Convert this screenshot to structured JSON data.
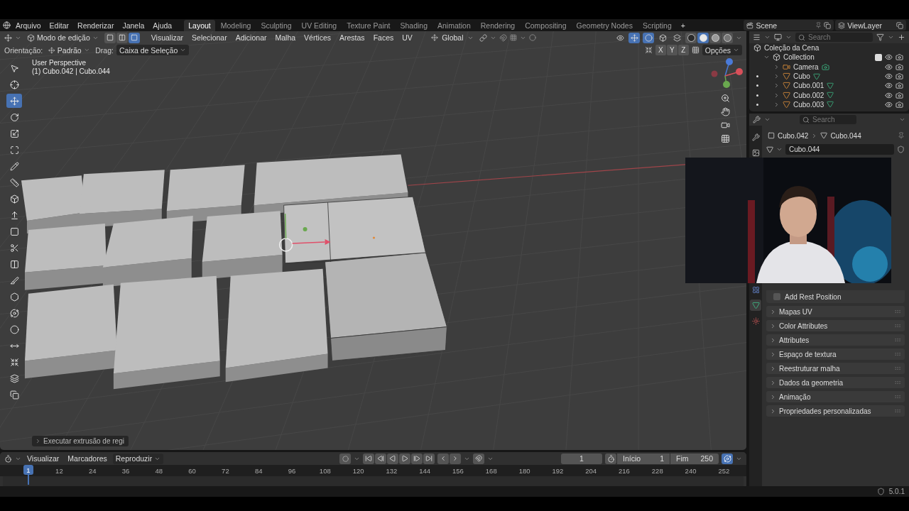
{
  "menu": [
    "Arquivo",
    "Editar",
    "Renderizar",
    "Janela",
    "Ajuda"
  ],
  "workspaces": [
    {
      "label": "Layout",
      "selected": true
    },
    {
      "label": "Modeling",
      "selected": false
    },
    {
      "label": "Sculpting",
      "selected": false
    },
    {
      "label": "UV Editing",
      "selected": false
    },
    {
      "label": "Texture Paint",
      "selected": false
    },
    {
      "label": "Shading",
      "selected": false
    },
    {
      "label": "Animation",
      "selected": false
    },
    {
      "label": "Rendering",
      "selected": false
    },
    {
      "label": "Compositing",
      "selected": false
    },
    {
      "label": "Geometry Nodes",
      "selected": false
    },
    {
      "label": "Scripting",
      "selected": false
    }
  ],
  "add_workspace": "+",
  "scene": "Scene",
  "view_layer": "ViewLayer",
  "viewport_header": {
    "mode": "Modo de edição",
    "select_modes": [
      {
        "kind": "vertex",
        "selected": false
      },
      {
        "kind": "edge",
        "selected": false
      },
      {
        "kind": "face",
        "selected": true
      }
    ],
    "menus": [
      "Visualizar",
      "Selecionar",
      "Adicionar",
      "Malha",
      "Vértices",
      "Arestas",
      "Faces",
      "UV"
    ],
    "transform": "Global",
    "toggles": [
      {
        "kind": "visibility",
        "on": false
      },
      {
        "kind": "gizmo",
        "on": true
      },
      {
        "kind": "overlay",
        "on": true
      },
      {
        "kind": "mesh_overlay",
        "on": false
      },
      {
        "kind": "xray",
        "on": false
      }
    ],
    "shading": [
      {
        "kind": "wireframe",
        "selected": false
      },
      {
        "kind": "solid",
        "selected": true
      },
      {
        "kind": "material",
        "selected": false
      },
      {
        "kind": "rendered",
        "selected": false
      }
    ]
  },
  "tool_settings": {
    "orientation_label": "Orientação:",
    "orientation": "Padrão",
    "drag_label": "Drag:",
    "drag": "Caixa de Seleção",
    "mirror_axes": [
      {
        "label": "X",
        "selected": false
      },
      {
        "label": "Y",
        "selected": false
      },
      {
        "label": "Z",
        "selected": false
      }
    ],
    "options": "Opções"
  },
  "viewport": {
    "view_name": "User Perspective",
    "object_info": "(1) Cubo.042 | Cubo.044",
    "last_operator": "Executar extrusão de regi",
    "tools": [
      {
        "kind": "select_box",
        "selected": false
      },
      {
        "kind": "cursor",
        "selected": false
      },
      {
        "kind": "move",
        "selected": true
      },
      {
        "kind": "rotate",
        "selected": false
      },
      {
        "kind": "scale",
        "selected": false
      },
      {
        "kind": "transform",
        "selected": false
      },
      {
        "kind": "annotate",
        "selected": false
      },
      {
        "kind": "measure",
        "selected": false
      },
      {
        "kind": "add_cube",
        "selected": false
      },
      {
        "kind": "extrude",
        "selected": false
      },
      {
        "kind": "inset",
        "selected": false
      },
      {
        "kind": "bevel",
        "selected": false
      },
      {
        "kind": "loop_cut",
        "selected": false
      },
      {
        "kind": "knife",
        "selected": false
      },
      {
        "kind": "poly_build",
        "selected": false
      },
      {
        "kind": "spin",
        "selected": false
      },
      {
        "kind": "smooth",
        "selected": false
      },
      {
        "kind": "edge_slide",
        "selected": false
      },
      {
        "kind": "shrink",
        "selected": false
      },
      {
        "kind": "shear",
        "selected": false
      },
      {
        "kind": "rip",
        "selected": false
      }
    ]
  },
  "outliner": {
    "search": {
      "placeholder": "Search"
    },
    "root": {
      "name": "Coleção da Cena",
      "children": [
        {
          "name": "Collection",
          "kind": "collection",
          "expanded": true,
          "checked": true,
          "children": [
            {
              "name": "Camera",
              "kind": "camera",
              "expanded": false,
              "edit_dot": false
            },
            {
              "name": "Cubo",
              "kind": "mesh",
              "expanded": false,
              "edit_dot": true
            },
            {
              "name": "Cubo.001",
              "kind": "mesh",
              "expanded": false,
              "edit_dot": true
            },
            {
              "name": "Cubo.002",
              "kind": "mesh",
              "expanded": false,
              "edit_dot": true
            },
            {
              "name": "Cubo.003",
              "kind": "mesh",
              "expanded": false,
              "edit_dot": true
            }
          ]
        }
      ]
    }
  },
  "properties": {
    "search": {
      "placeholder": "Search"
    },
    "object": "Cubo.042",
    "mesh": "Cubo.044",
    "mesh_name": "Cubo.044",
    "tabs": [
      {
        "kind": "tool",
        "selected": false
      },
      {
        "kind": "render",
        "selected": false
      },
      {
        "kind": "physics",
        "selected": false
      },
      {
        "kind": "data",
        "selected": true
      },
      {
        "kind": "material",
        "selected": false
      }
    ],
    "add_rest_position": {
      "label": "Add Rest Position",
      "checked": false
    },
    "panels": [
      {
        "label": "Mapas UV",
        "expanded": false
      },
      {
        "label": "Color Attributes",
        "expanded": false
      },
      {
        "label": "Attributes",
        "expanded": false
      },
      {
        "label": "Espaço de textura",
        "expanded": false
      },
      {
        "label": "Reestruturar malha",
        "expanded": false
      },
      {
        "label": "Dados da geometria",
        "expanded": false
      },
      {
        "label": "Animação",
        "expanded": false
      },
      {
        "label": "Propriedades personalizadas",
        "expanded": false
      }
    ]
  },
  "timeline": {
    "menus": [
      "Visualizar",
      "Marcadores"
    ],
    "playback": "Reproduzir",
    "current_frame": "1",
    "start_label": "Início",
    "start": "1",
    "end_label": "Fim",
    "end": "250",
    "playhead": "1",
    "ticks": [
      "12",
      "24",
      "36",
      "48",
      "60",
      "72",
      "84",
      "96",
      "108",
      "120",
      "132",
      "144",
      "156",
      "168",
      "180",
      "192",
      "204",
      "216",
      "228",
      "240",
      "252"
    ]
  },
  "status": {
    "version": "5.0.1"
  }
}
